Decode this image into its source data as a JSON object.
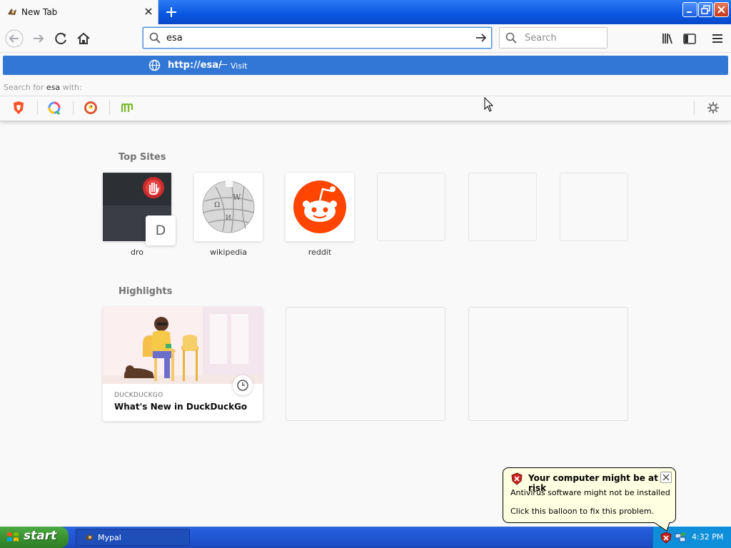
{
  "tab": {
    "title": "New Tab"
  },
  "nav": {
    "url_value": "esa",
    "search_placeholder": "Search"
  },
  "popup": {
    "suggestion_url": "http://esa/",
    "suggestion_separator": "—",
    "suggestion_action": "Visit",
    "search_with_prefix": "Search for",
    "search_with_term": "esa",
    "search_with_suffix": "with:",
    "engines": [
      "brave-icon",
      "qwant-icon",
      "duckduckgo-icon",
      "mojeek-icon"
    ]
  },
  "top_sites": {
    "heading": "Top Sites",
    "sites": [
      {
        "label": "dro",
        "letter": "D"
      },
      {
        "label": "wikipedia"
      },
      {
        "label": "reddit"
      }
    ]
  },
  "highlights": {
    "heading": "Highlights",
    "cards": [
      {
        "source": "DUCKDUCKGO",
        "title": "What's New in DuckDuckGo"
      }
    ]
  },
  "balloon": {
    "title": "Your computer might be at risk",
    "line1": "Antivirus software might not be installed",
    "line2": "Click this balloon to fix this problem."
  },
  "taskbar": {
    "start_label": "start",
    "task_label": "Mypal",
    "clock": "4:32 PM"
  },
  "colors": {
    "accent": "#3277d4",
    "reddit": "#ff4500",
    "xp_blue": "#245edc",
    "xp_green": "#3a9130"
  }
}
